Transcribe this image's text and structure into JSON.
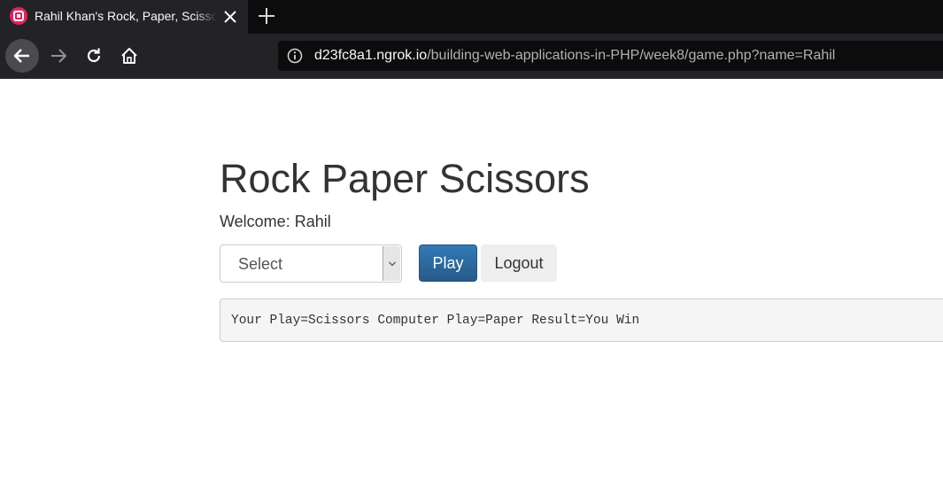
{
  "browser": {
    "tab": {
      "title": "Rahil Khan's Rock, Paper, Scissors Game",
      "favicon": "app-favicon",
      "close_icon": "close-icon"
    },
    "new_tab_icon": "plus-icon",
    "nav": {
      "back_icon": "back-arrow-icon",
      "forward_icon": "forward-arrow-icon",
      "reload_icon": "reload-icon",
      "home_icon": "home-icon"
    },
    "address": {
      "info_icon": "info-icon",
      "host": "d23fc8a1.ngrok.io",
      "path": "/building-web-applications-in-PHP/week8/game.php?name=Rahil"
    }
  },
  "page": {
    "title": "Rock Paper Scissors",
    "welcome": "Welcome: Rahil",
    "select": {
      "value": "Select",
      "arrow_icon": "chevron-down-icon"
    },
    "buttons": {
      "play": "Play",
      "logout": "Logout"
    },
    "result": "Your Play=Scissors Computer Play=Paper Result=You Win"
  },
  "colors": {
    "chrome_dark": "#0c0c0d",
    "chrome_bar": "#232327",
    "primary_button": "#337ab7",
    "text": "#333333"
  }
}
